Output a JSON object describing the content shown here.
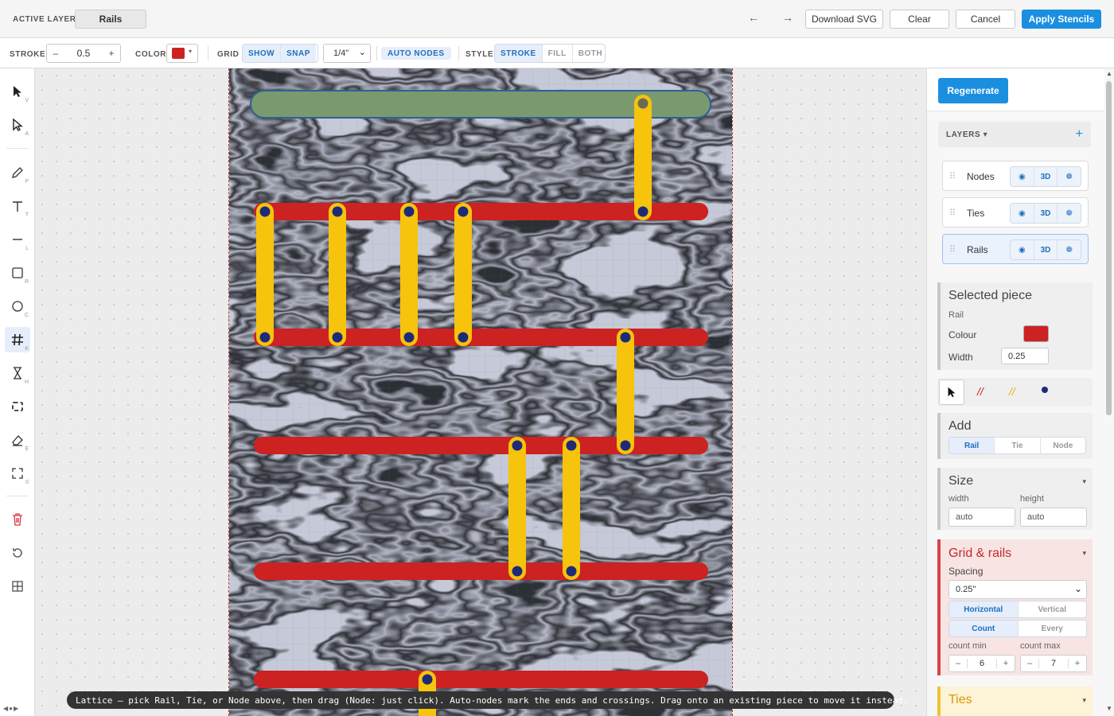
{
  "topbar": {
    "active_layer_label": "ACTIVE LAYER",
    "active_layer_value": "Rails",
    "undo_icon": "arrow-left-icon",
    "redo_icon": "arrow-right-icon",
    "download_label": "Download SVG",
    "clear_label": "Clear",
    "cancel_label": "Cancel",
    "apply_label": "Apply Stencils"
  },
  "toolbar": {
    "stroke_label": "STROKE",
    "stroke_minus": "–",
    "stroke_value": "0.5",
    "stroke_plus": "+",
    "color_label": "COLOR",
    "color_value": "#cc2222",
    "grid_label": "GRID",
    "grid_show": "SHOW",
    "grid_snap": "SNAP",
    "grid_spacing": "1/4\"",
    "auto_nodes": "AUTO NODES",
    "style_label": "STYLE",
    "style_stroke": "STROKE",
    "style_fill": "FILL",
    "style_both": "BOTH"
  },
  "tools": [
    {
      "name": "select-arrow-icon",
      "key": "V"
    },
    {
      "name": "direct-select-icon",
      "key": "A"
    },
    {
      "name": "pen-icon",
      "key": "P"
    },
    {
      "name": "text-icon",
      "key": "T"
    },
    {
      "name": "line-icon",
      "key": "L"
    },
    {
      "name": "rectangle-icon",
      "key": "R"
    },
    {
      "name": "circle-icon",
      "key": "C"
    },
    {
      "name": "lattice-hash-icon",
      "key": "K"
    },
    {
      "name": "hourglass-icon",
      "key": "H"
    },
    {
      "name": "frame-select-icon",
      "key": ""
    },
    {
      "name": "eraser-icon",
      "key": "E"
    },
    {
      "name": "fit-view-icon",
      "key": "0"
    },
    {
      "name": "trash-icon",
      "key": ""
    },
    {
      "name": "reset-icon",
      "key": ""
    },
    {
      "name": "grid-layout-icon",
      "key": ""
    }
  ],
  "hint": "Lattice — pick Rail, Tie, or Node above, then drag (Node: just click). Auto-nodes mark the ends and crossings. Drag onto an existing piece to move it instead.",
  "panel": {
    "regenerate": "Regenerate",
    "layers_title": "LAYERS ▾",
    "add_layer": "+",
    "layers": [
      {
        "name": "Nodes",
        "icon_eye": "eye-icon",
        "icon_3d": "3D",
        "icon_palette": "palette-icon"
      },
      {
        "name": "Ties",
        "icon_eye": "eye-icon",
        "icon_3d": "3D",
        "icon_palette": "palette-icon"
      },
      {
        "name": "Rails",
        "icon_eye": "eye-icon",
        "icon_3d": "3D",
        "icon_palette": "palette-icon"
      }
    ],
    "selected": {
      "title": "Selected piece",
      "type": "Rail",
      "colour_label": "Colour",
      "colour_value": "#cc2222",
      "width_label": "Width",
      "width_value": "0.25"
    },
    "add": {
      "title": "Add",
      "options": [
        "Rail",
        "Tie",
        "Node"
      ]
    },
    "size": {
      "title": "Size",
      "width_label": "width",
      "height_label": "height",
      "width_value": "auto",
      "height_value": "auto"
    },
    "grid_rails": {
      "title": "Grid & rails",
      "spacing_label": "Spacing",
      "spacing_value": "0.25\"",
      "orient_options": [
        "Horizontal",
        "Vertical"
      ],
      "mode_options": [
        "Count",
        "Every"
      ],
      "count_min_label": "count min",
      "count_min_value": "6",
      "count_max_label": "count max",
      "count_max_value": "7",
      "minus": "–",
      "plus": "+"
    },
    "ties_title": "Ties"
  },
  "colors": {
    "rail": "#cc2222",
    "tie": "#f6c30d",
    "node": "#1e2a78",
    "bar": "#7a9a6e",
    "accent": "#1a8fe0"
  }
}
